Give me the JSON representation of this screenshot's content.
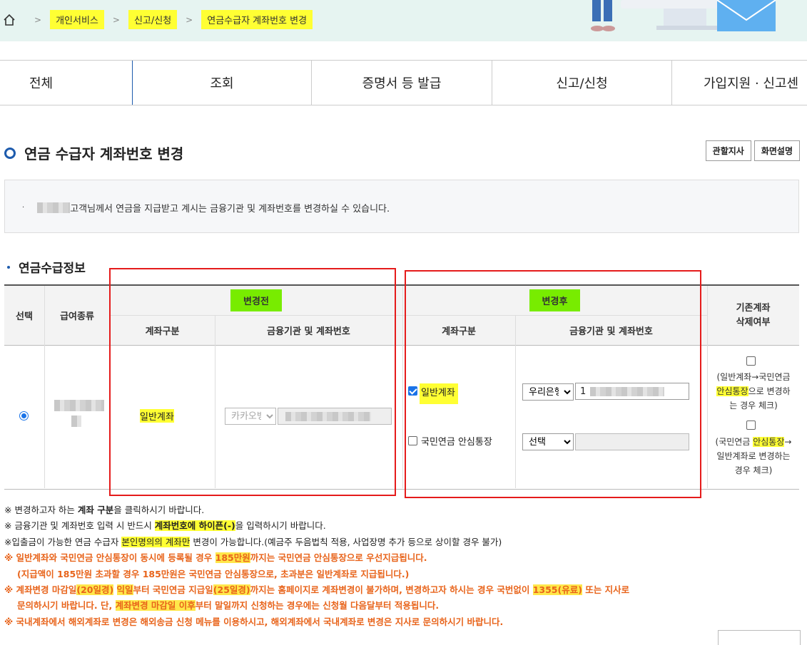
{
  "breadcrumb": {
    "items": [
      "개인서비스",
      "신고/신청",
      "연금수급자 계좌번호 변경"
    ]
  },
  "tabs": [
    "전체",
    "조회",
    "증명서 등 발급",
    "신고/신청",
    "가입지원 · 신고센"
  ],
  "page": {
    "title": "연금 수급자 계좌번호 변경",
    "btn_branch": "관할지사",
    "btn_help": "화면설명",
    "info_text": "고객님께서 연금을 지급받고 계시는 금융기관 및 계좌번호를 변경하실 수 있습니다."
  },
  "section_title": "연금수급정보",
  "table": {
    "h_select": "선택",
    "h_type": "급여종류",
    "h_before": "변경전",
    "h_after": "변경후",
    "h_delete_1": "기존계좌",
    "h_delete_2": "삭제여부",
    "h_acct_type": "계좌구분",
    "h_bank_acct": "금융기관 및 계좌번호",
    "h_acct_type_2": "계좌구분",
    "h_bank_acct_2": "금융기관 및 계좌번호",
    "before_type": "일반계좌",
    "before_bank": "카카오뱅크",
    "after_opt1": "일반계좌",
    "after_opt1_checked": true,
    "after_opt2": "국민연금 안심통장",
    "after_opt2_checked": false,
    "after_bank1": "우리은행",
    "after_acct1_prefix": "1",
    "after_bank2": "선택",
    "del_note1_a": "(일반계좌→국민연금",
    "del_note1_b": "안심통장",
    "del_note1_c": "으로 변경하",
    "del_note1_d": "는 경우 체크)",
    "del_note2_a": "(국민연금",
    "del_note2_b": "안심통장",
    "del_note2_c": "→",
    "del_note2_d": "일반계좌로 변경하는",
    "del_note2_e": "경우 체크)"
  },
  "notes": {
    "n1_a": "※ 변경하고자 하는 ",
    "n1_b": "계좌 구분",
    "n1_c": "을 클릭하시기 바랍니다.",
    "n2_a": "※ 금융기관 및 계좌번호 입력 시 반드시 ",
    "n2_b": "계좌번호에 하이픈(-)",
    "n2_c": "을 입력하시기 바랍니다.",
    "n3_a": "※입출금이 가능한 연금 수급자 ",
    "n3_b": "본인명의의 계좌만",
    "n3_c": " 변경이 가능합니다.(예금주 두음법칙 적용, 사업장명 추가 등으로 상이할 경우 불가)",
    "n4_a": "※ 일반계좌와 국민연금 안심통장이 동시에 등록될 경우 ",
    "n4_b": "185만원",
    "n4_c": "까지는 국민연금 안심통장으로 우선지급됩니다.",
    "n5": "(지급액이 185만원 초과할 경우 185만원은 국민연금 안심통장으로, 초과분은 일반계좌로 지급됩니다.)",
    "n6_a": "※ 계좌변경 마감일",
    "n6_b": "(20일경)",
    "n6_c": " ",
    "n6_d": "익일",
    "n6_e": "부터 국민연금 지급일",
    "n6_f": "(25일경)",
    "n6_g": "까지는 홈페이지로 계좌변경이 불가하며, 변경하고자 하시는 경우 국번없이 ",
    "n6_h": "1355(유료)",
    "n6_i": " 또는 지사로",
    "n7_a": "문의하시기 바랍니다. 단, ",
    "n7_b": "계좌변경 마감일 이후",
    "n7_c": "부터 말일까지 신청하는 경우에는 신청월 다음달부터 적용됩니다.",
    "n8": "※ 국내계좌에서 해외계좌로 변경은 해외송금 신청 메뉴를 이용하시고, 해외계좌에서 국내계좌로 변경은 지사로 문의하시기 바랍니다."
  },
  "colors": {
    "accent": "#1d5bad",
    "highlight": "#ffff33",
    "green_label": "#78ec00",
    "red_box": "#e51b1b",
    "orange_note": "#e8641b"
  }
}
